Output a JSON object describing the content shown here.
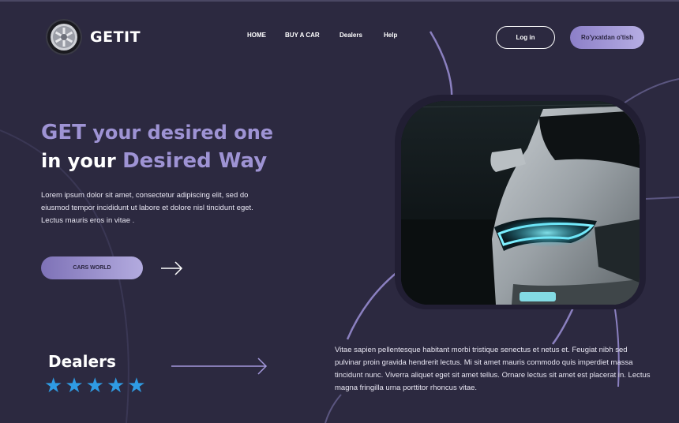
{
  "brand": {
    "name": "GETIT"
  },
  "nav": {
    "items": [
      "HOME",
      "BUY A CAR",
      "Dealers",
      "Help"
    ]
  },
  "auth": {
    "login_label": "Log in",
    "register_label": "Ro'yxatdan o'tish"
  },
  "hero": {
    "title_get": "GET",
    "title_line1_rest": " your desired one",
    "title_line2_prefix": "in your ",
    "title_line2_accent": "Desired Way",
    "description": "Lorem ipsum dolor sit amet, consectetur adipiscing elit, sed do eiusmod tempor incididunt ut labore et dolore nisl tincidunt eget. Lectus mauris eros in vitae .",
    "cta_label": "CARS WORLD"
  },
  "dealers": {
    "title": "Dealers",
    "rating": 5
  },
  "bottom": {
    "text": "Vitae sapien pellentesque habitant morbi tristique senectus et netus et. Feugiat nibh sed pulvinar proin gravida hendrerit lectus. Mi sit amet mauris commodo quis imperdiet massa tincidunt nunc. Viverra aliquet eget sit amet tellus. Ornare lectus sit amet est placerat in. Lectus magna fringilla urna porttitor rhoncus vitae."
  },
  "colors": {
    "background": "#2c2940",
    "accent": "#9e93d4",
    "button_gradient_start": "#8c7fc8",
    "button_gradient_end": "#b6aee3",
    "star": "#2f9be3"
  },
  "icons": {
    "logo": "wheel-icon",
    "cta_arrow": "arrow-right-icon",
    "dealers_arrow": "arrow-right-icon",
    "rating": "star-icon"
  }
}
